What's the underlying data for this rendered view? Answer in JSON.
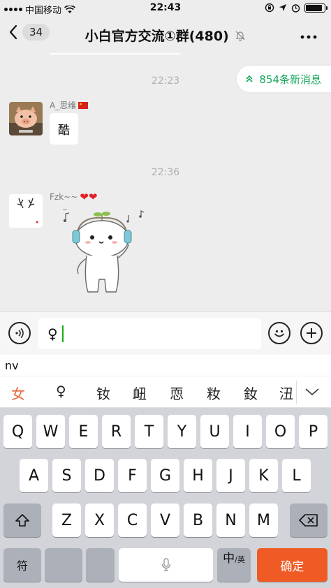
{
  "status_bar": {
    "carrier": "中国移动",
    "time": "22:43"
  },
  "nav": {
    "back_count": "34",
    "title": "小白官方交流①群(480)"
  },
  "chat": {
    "new_messages": "854条新消息",
    "time1": "22:23",
    "msg1": {
      "sender": "A_思维",
      "text": "酷"
    },
    "time2": "22:36",
    "msg2": {
      "sender": "Fzk~~"
    }
  },
  "input": {
    "text": "♀"
  },
  "ime": {
    "composing": "nv",
    "candidates": [
      "女",
      "♀",
      "钕",
      "衄",
      "恧",
      "籹",
      "釹",
      "沑"
    ]
  },
  "keyboard": {
    "row1": [
      "Q",
      "W",
      "E",
      "R",
      "T",
      "Y",
      "U",
      "I",
      "O",
      "P"
    ],
    "row2": [
      "A",
      "S",
      "D",
      "F",
      "G",
      "H",
      "J",
      "K",
      "L"
    ],
    "row3": [
      "Z",
      "X",
      "C",
      "V",
      "B",
      "N",
      "M"
    ],
    "symbol_key": "符",
    "lang_key_main": "中",
    "lang_key_sub": "/英",
    "confirm_key": "确定"
  },
  "colors": {
    "accent_green": "#14a65a",
    "confirm_orange": "#f05a24",
    "candidate_active": "#e7663b"
  }
}
